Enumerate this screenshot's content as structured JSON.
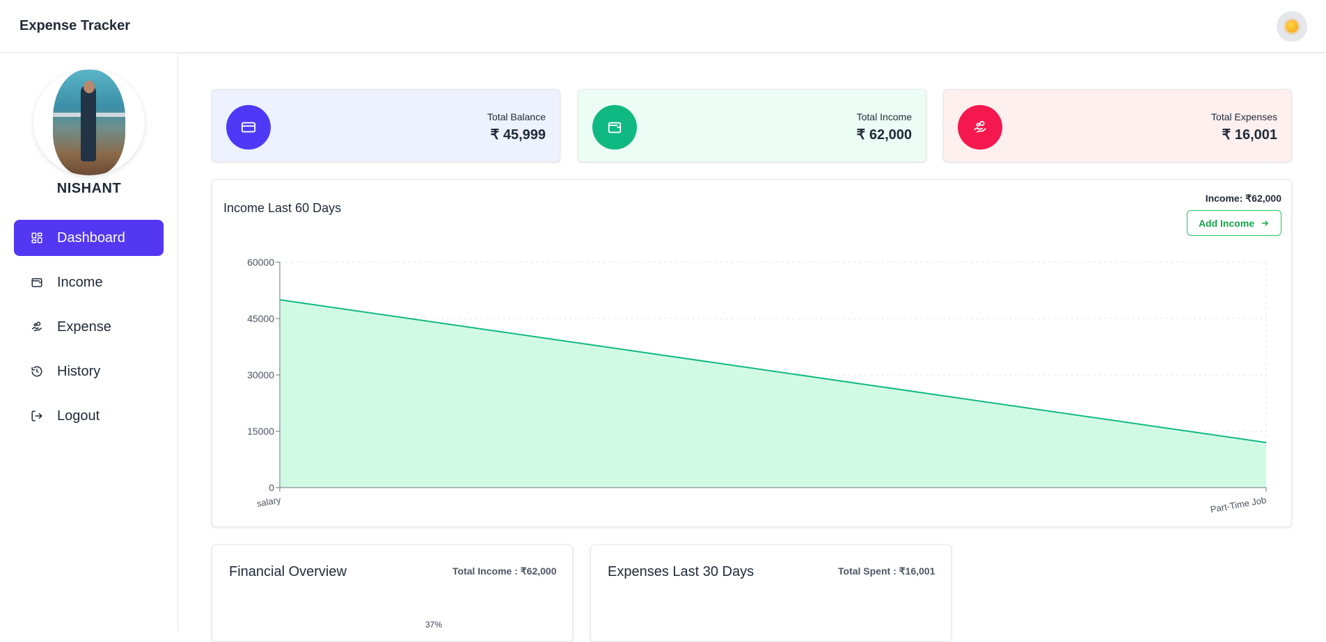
{
  "header": {
    "title": "Expense Tracker",
    "theme_icon": "sun-icon"
  },
  "sidebar": {
    "user_name": "NISHANT",
    "items": [
      {
        "label": "Dashboard",
        "icon": "dashboard-icon",
        "active": true
      },
      {
        "label": "Income",
        "icon": "wallet-icon",
        "active": false
      },
      {
        "label": "Expense",
        "icon": "hand-coins-icon",
        "active": false
      },
      {
        "label": "History",
        "icon": "history-icon",
        "active": false
      },
      {
        "label": "Logout",
        "icon": "logout-icon",
        "active": false
      }
    ]
  },
  "stats": [
    {
      "label": "Total Balance",
      "value": "₹ 45,999",
      "color": "#4f39f6",
      "bg": "#eef2ff",
      "icon": "credit-card-icon"
    },
    {
      "label": "Total Income",
      "value": "₹ 62,000",
      "color": "#10b981",
      "bg": "#ecfdf5",
      "icon": "wallet-icon"
    },
    {
      "label": "Total Expenses",
      "value": "₹ 16,001",
      "color": "#f5184e",
      "bg": "#fff0f0",
      "icon": "hand-coins-icon"
    }
  ],
  "income_chart": {
    "title": "Income Last 60 Days",
    "summary": "Income: ₹62,000",
    "add_button": "Add Income"
  },
  "chart_data": {
    "type": "area",
    "categories": [
      "salary",
      "Part-Time Job"
    ],
    "values": [
      50000,
      12000
    ],
    "ylim": [
      0,
      60000
    ],
    "yticks": [
      0,
      15000,
      30000,
      45000,
      60000
    ],
    "grid": true,
    "line_color": "#10b981",
    "fill_color": "#d1fae5"
  },
  "financial_overview": {
    "title": "Financial Overview",
    "meta": "Total Income : ₹62,000",
    "percent_label": "37%"
  },
  "expenses_30": {
    "title": "Expenses Last 30 Days",
    "meta": "Total Spent : ₹16,001"
  }
}
